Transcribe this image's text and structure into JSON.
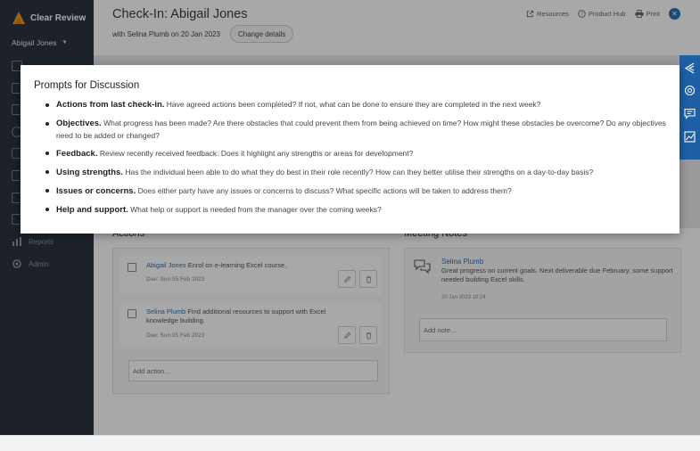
{
  "brand": {
    "name": "Clear Review",
    "color": "#f39c12"
  },
  "sidebar": {
    "user": "Abigail Jones",
    "items": [
      {
        "label": "Reports",
        "icon": "reports-icon"
      },
      {
        "label": "Admin",
        "icon": "admin-gear-icon"
      }
    ]
  },
  "header": {
    "title": "Check-In: Abigail Jones",
    "subtitle": "with Selina Plumb on 20 Jan 2023",
    "change_label": "Change details",
    "links": {
      "resources": "Resources",
      "product_hub": "Product Hub",
      "print": "Print"
    },
    "close_glyph": "✕"
  },
  "actions": {
    "title": "Actions",
    "items": [
      {
        "person": "Abigail Jones",
        "text": "Enrol on e-learning Excel course.",
        "due": "Due: Sun 05 Feb 2023"
      },
      {
        "person": "Selina Plumb",
        "text": "Find additional resources to support with Excel knowledge building.",
        "due": "Due: Sun 05 Feb 2023"
      }
    ],
    "add_placeholder": "Add action..."
  },
  "notes": {
    "title": "Meeting Notes",
    "items": [
      {
        "author": "Selina Plumb",
        "text": "Great progress on current goals. Next deliverable due February, some support needed building Excel skills.",
        "time": "20 Jan 2023 10:24"
      }
    ],
    "add_placeholder": "Add note..."
  },
  "modal": {
    "title": "Prompts for Discussion",
    "prompts": [
      {
        "heading": "Actions from last check-in.",
        "text": "Have agreed actions been completed? If not, what can be done to ensure they are completed in the next week?"
      },
      {
        "heading": "Objectives.",
        "text": "What progress has been made? Are there obstacles that could prevent them from being achieved on time? How might these obstacles be overcome? Do any objectives need to be added or changed?"
      },
      {
        "heading": "Feedback.",
        "text": "Review recently received feedback. Does it highlight any strengths or areas for development?"
      },
      {
        "heading": "Using strengths.",
        "text": "Has the individual been able to do what they do best in their role recently? How can they better utilise their strengths on a day-to-day basis?"
      },
      {
        "heading": "Issues or concerns.",
        "text": "Does either party have any issues or concerns to discuss? What specific actions will be taken to address them?"
      },
      {
        "heading": "Help and support.",
        "text": "What help or support is needed from the manager over the coming weeks?"
      }
    ]
  },
  "colors": {
    "accent": "#2f6fb5",
    "sidebar": "#2d3440",
    "rail": "#1f5fa6"
  }
}
